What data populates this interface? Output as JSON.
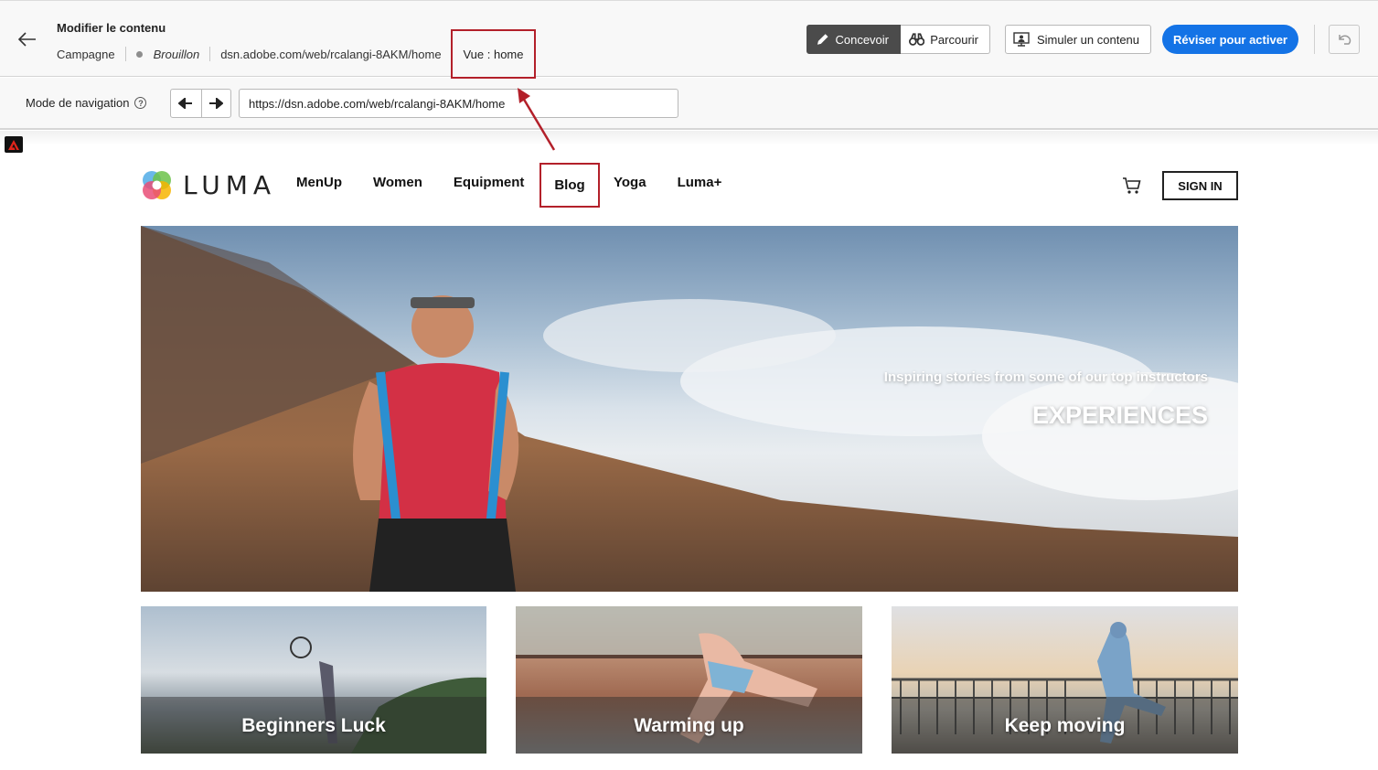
{
  "header": {
    "title": "Modifier le contenu",
    "campaign_label": "Campagne",
    "status": "Brouillon",
    "url": "dsn.adobe.com/web/rcalangi-8AKM/home",
    "view_label": "Vue : home",
    "mode_design": "Concevoir",
    "mode_browse": "Parcourir",
    "simulate": "Simuler un contenu",
    "review": "Réviser pour activer"
  },
  "nav": {
    "mode_label": "Mode de navigation",
    "help_glyph": "?",
    "url_value": "https://dsn.adobe.com/web/rcalangi-8AKM/home"
  },
  "site": {
    "brand": "LUMA",
    "menu": [
      "MenUp",
      "Women",
      "Equipment",
      "Blog",
      "Yoga",
      "Luma+"
    ],
    "sign_in": "SIGN IN",
    "hero_subtitle": "Inspiring stories from some of our top instructors",
    "hero_title": "EXPERIENCES",
    "cards": [
      "Beginners Luck",
      "Warming up",
      "Keep moving"
    ]
  },
  "colors": {
    "accent_blue": "#1473e6",
    "annotation_red": "#b3202a",
    "active_mode": "#4b4b4b"
  },
  "icons": [
    "back-arrow-icon",
    "pencil-icon",
    "binoculars-icon",
    "simulate-icon",
    "undo-icon",
    "help-icon",
    "arrow-left-icon",
    "arrow-right-icon",
    "adobe-icon",
    "cart-icon"
  ]
}
